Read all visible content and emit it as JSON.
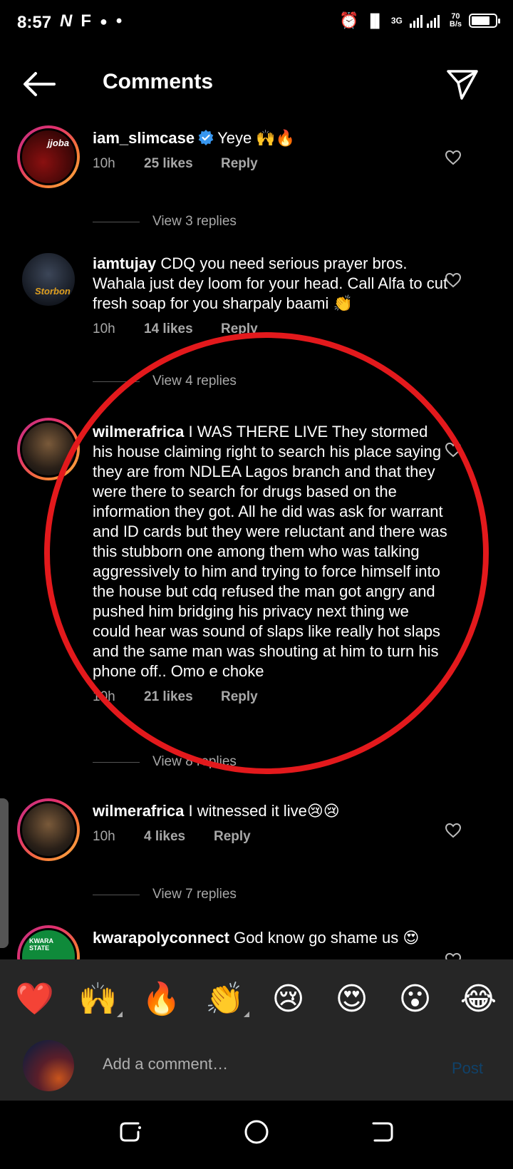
{
  "status_bar": {
    "time": "8:57",
    "left_icons": [
      "N",
      "F",
      "●",
      "•"
    ],
    "network": "3G",
    "speed_top": "70",
    "speed_bottom": "B/s"
  },
  "header": {
    "title": "Comments"
  },
  "comments": [
    {
      "username": "iam_slimcase",
      "verified": true,
      "text": "Yeye 🙌🔥",
      "time": "10h",
      "likes": "25 likes",
      "reply": "Reply",
      "view_replies": "View 3 replies",
      "avatar_text": "jjoba"
    },
    {
      "username": "iamtujay",
      "verified": false,
      "text": "CDQ you need serious prayer bros. Wahala just dey loom for your head. Call Alfa to cut fresh soap for you sharpaly baami 👏",
      "time": "10h",
      "likes": "14 likes",
      "reply": "Reply",
      "view_replies": "View 4 replies",
      "avatar_text": "Storbon"
    },
    {
      "username": "wilmerafrica",
      "verified": false,
      "text": "I WAS THERE LIVE They stormed his house claiming right to search his place saying they are from NDLEA Lagos branch and that they were there to search for drugs based on the information they got. All he did was ask for warrant and  ID cards but they were reluctant and there was this stubborn one among them who was talking aggressively to him and trying to force himself into the house but cdq refused the man got angry and pushed him bridging his privacy next thing we could hear was sound of slaps like really hot slaps and the same man was shouting at him to turn his phone off.. Omo e choke",
      "time": "10h",
      "likes": "21 likes",
      "reply": "Reply",
      "view_replies": "View 8 replies"
    },
    {
      "username": "wilmerafrica",
      "verified": false,
      "text": "I witnessed it live😢😢",
      "time": "10h",
      "likes": "4 likes",
      "reply": "Reply",
      "view_replies": "View 7 replies"
    },
    {
      "username": "kwarapolyconnect",
      "verified": false,
      "text": "God know go shame us 😍",
      "avatar_text": "KWARA STATE"
    }
  ],
  "reactions": [
    "❤️",
    "🙌",
    "🔥",
    "👏",
    "😢",
    "😍",
    "😮",
    "😂"
  ],
  "comment_input": {
    "placeholder": "Add a comment…",
    "post_label": "Post"
  },
  "colors": {
    "background": "#000000",
    "secondary_text": "#a8a8a8",
    "bar_background": "#262626",
    "post_disabled": "#10426a",
    "annotation_circle": "#e3191c",
    "verified_blue": "#3897f0"
  }
}
